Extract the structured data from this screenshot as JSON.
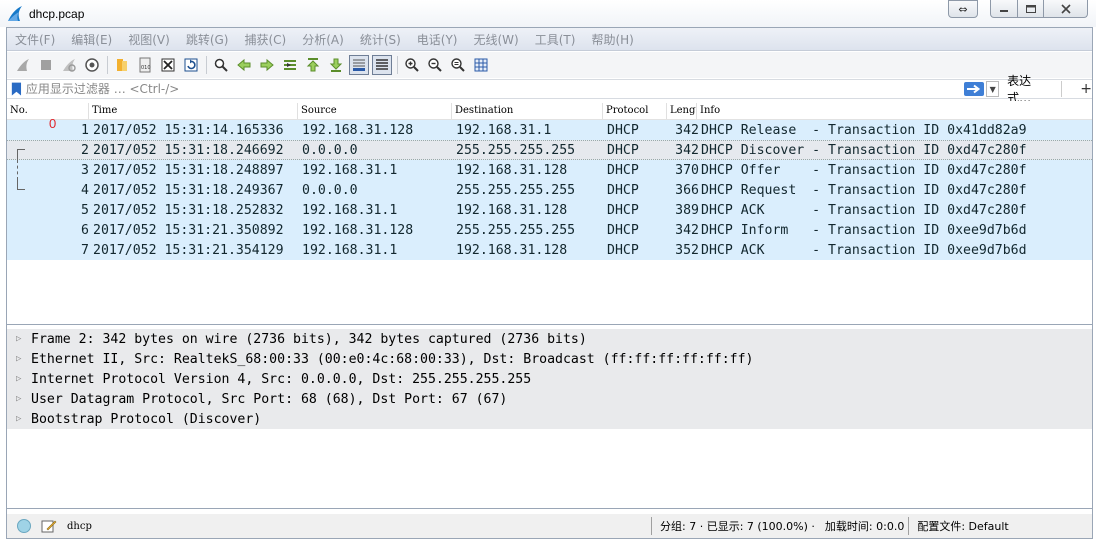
{
  "window": {
    "title": "dhcp.pcap"
  },
  "menu": [
    "文件(F)",
    "编辑(E)",
    "视图(V)",
    "跳转(G)",
    "捕获(C)",
    "分析(A)",
    "统计(S)",
    "电话(Y)",
    "无线(W)",
    "工具(T)",
    "帮助(H)"
  ],
  "toolbar": {
    "icons": [
      "shark-fin-start-icon",
      "stop-icon",
      "restart-icon",
      "options-gear-icon",
      "open-folder-icon",
      "save-file-icon",
      "close-file-icon",
      "reload-icon",
      "find-icon",
      "back-arrow-icon",
      "forward-arrow-icon",
      "goto-packet-icon",
      "first-packet-icon",
      "last-packet-icon",
      "autoscroll-icon",
      "colorize-icon",
      "zoom-in-icon",
      "zoom-out-icon",
      "zoom-normal-icon",
      "resize-columns-icon"
    ]
  },
  "filter": {
    "placeholder": "应用显示过滤器 … <Ctrl-/>",
    "expression_label": "表达式…",
    "add_label": "+"
  },
  "packet_list": {
    "columns": [
      "No.",
      "Time",
      "Source",
      "Destination",
      "Protocol",
      "Length",
      "Info"
    ],
    "marker": "0",
    "rows": [
      {
        "no": "1",
        "time": "2017/052 15:31:14.165336",
        "src": "192.168.31.128",
        "dst": "192.168.31.1",
        "proto": "DHCP",
        "len": "342",
        "info": "DHCP Release  - Transaction ID 0x41dd82a9"
      },
      {
        "no": "2",
        "time": "2017/052 15:31:18.246692",
        "src": "0.0.0.0",
        "dst": "255.255.255.255",
        "proto": "DHCP",
        "len": "342",
        "info": "DHCP Discover - Transaction ID 0xd47c280f"
      },
      {
        "no": "3",
        "time": "2017/052 15:31:18.248897",
        "src": "192.168.31.1",
        "dst": "192.168.31.128",
        "proto": "DHCP",
        "len": "370",
        "info": "DHCP Offer    - Transaction ID 0xd47c280f"
      },
      {
        "no": "4",
        "time": "2017/052 15:31:18.249367",
        "src": "0.0.0.0",
        "dst": "255.255.255.255",
        "proto": "DHCP",
        "len": "366",
        "info": "DHCP Request  - Transaction ID 0xd47c280f"
      },
      {
        "no": "5",
        "time": "2017/052 15:31:18.252832",
        "src": "192.168.31.1",
        "dst": "192.168.31.128",
        "proto": "DHCP",
        "len": "389",
        "info": "DHCP ACK      - Transaction ID 0xd47c280f"
      },
      {
        "no": "6",
        "time": "2017/052 15:31:21.350892",
        "src": "192.168.31.128",
        "dst": "255.255.255.255",
        "proto": "DHCP",
        "len": "342",
        "info": "DHCP Inform   - Transaction ID 0xee9d7b6d"
      },
      {
        "no": "7",
        "time": "2017/052 15:31:21.354129",
        "src": "192.168.31.1",
        "dst": "192.168.31.128",
        "proto": "DHCP",
        "len": "352",
        "info": "DHCP ACK      - Transaction ID 0xee9d7b6d"
      }
    ],
    "selected_row": 2
  },
  "details": [
    "Frame 2: 342 bytes on wire (2736 bits), 342 bytes captured (2736 bits)",
    "Ethernet II, Src: RealtekS_68:00:33 (00:e0:4c:68:00:33), Dst: Broadcast (ff:ff:ff:ff:ff:ff)",
    "Internet Protocol Version 4, Src: 0.0.0.0, Dst: 255.255.255.255",
    "User Datagram Protocol, Src Port: 68 (68), Dst Port: 67 (67)",
    "Bootstrap Protocol (Discover)"
  ],
  "status": {
    "file_label": "dhcp",
    "packets": "分组: 7 · 已显示: 7 (100.0%) ·",
    "load_time": "加载时间: 0:0.0",
    "profile": "配置文件: Default"
  },
  "colors": {
    "row_bg": "#daeefd",
    "selected_bg": "#e6e9ee",
    "apply_button": "#3f7fd6",
    "marker": "#e0242a"
  }
}
